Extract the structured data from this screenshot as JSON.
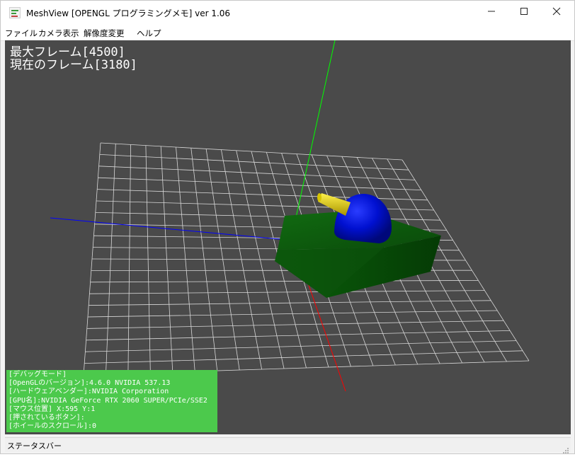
{
  "window": {
    "title": "MeshView [OPENGL プログラミングメモ] ver 1.06",
    "minimize_glyph": "—",
    "maximize_glyph": "☐",
    "close_glyph": "✕"
  },
  "menu": {
    "items": [
      "ファイル",
      "カメラ表示",
      "解像度変更",
      "ヘルプ"
    ]
  },
  "viewport": {
    "max_frame": "最大フレーム[4500]",
    "current_frame": "現在のフレーム[3180]",
    "background_color": "#4a4a4a"
  },
  "debug": {
    "lines": [
      "[デバッグモード]",
      "[OpenGLのバージョン]:4.6.0 NVIDIA 537.13",
      "[ハードウェアベンダー]:NVIDIA Corporation",
      "[GPU名]:NVIDIA GeForce RTX 2060 SUPER/PCIe/SSE2",
      "[マウス位置] X:595 Y:1",
      "[押されているボタン]:",
      "[ホイールのスクロール]:0"
    ],
    "panel_color": "#4cc94c"
  },
  "status": {
    "text": "ステータスバー"
  },
  "colors": {
    "x_axis": "#ff0000",
    "y_axis": "#00ff00",
    "z_axis": "#0000ff",
    "tank_body": "#0d5a0d",
    "turret": "#0010d0",
    "barrel": "#e0d000",
    "grid": "#d8d8d8"
  }
}
